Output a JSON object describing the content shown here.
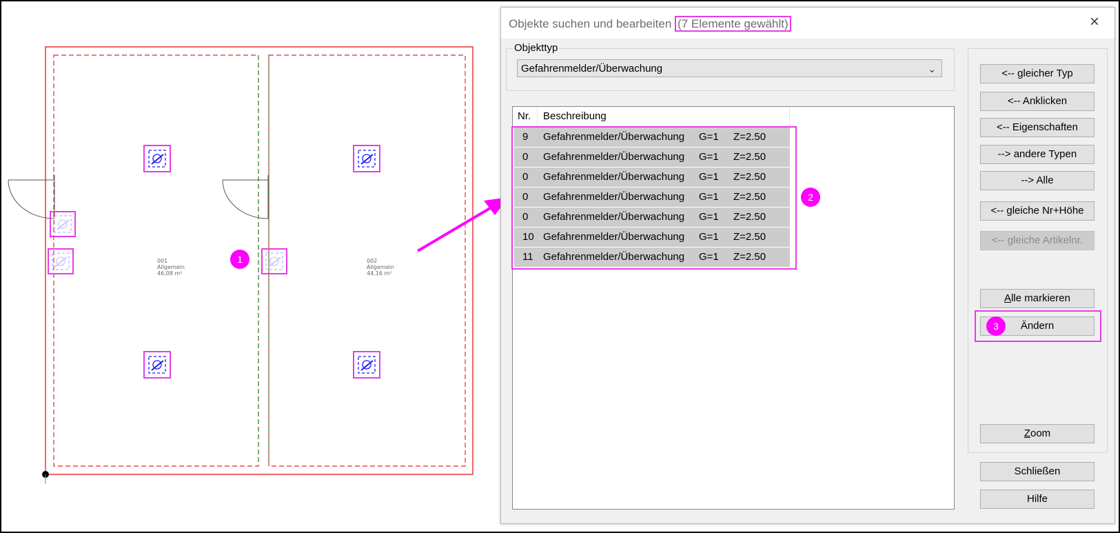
{
  "dialog": {
    "title": "Objekte suchen und bearbeiten",
    "title_count": "(7 Elemente gewählt)",
    "close_icon": "×"
  },
  "object_type": {
    "label": "Objekttyp",
    "selected": "Gefahrenmelder/Überwachung"
  },
  "list": {
    "headers": [
      "Nr.",
      "Beschreibung"
    ],
    "rows": [
      {
        "nr": "9",
        "desc": "Gefahrenmelder/Überwachung",
        "g": "G=1",
        "z": "Z=2.50"
      },
      {
        "nr": "0",
        "desc": "Gefahrenmelder/Überwachung",
        "g": "G=1",
        "z": "Z=2.50"
      },
      {
        "nr": "0",
        "desc": "Gefahrenmelder/Überwachung",
        "g": "G=1",
        "z": "Z=2.50"
      },
      {
        "nr": "0",
        "desc": "Gefahrenmelder/Überwachung",
        "g": "G=1",
        "z": "Z=2.50"
      },
      {
        "nr": "0",
        "desc": "Gefahrenmelder/Überwachung",
        "g": "G=1",
        "z": "Z=2.50"
      },
      {
        "nr": "10",
        "desc": "Gefahrenmelder/Überwachung",
        "g": "G=1",
        "z": "Z=2.50"
      },
      {
        "nr": "11",
        "desc": "Gefahrenmelder/Überwachung",
        "g": "G=1",
        "z": "Z=2.50"
      }
    ]
  },
  "buttons": {
    "same_type": "<-- gleicher Typ",
    "click": "<-- Anklicken",
    "properties": "<-- Eigenschaften",
    "other_types": "--> andere Typen",
    "all": "--> Alle",
    "same_nr_height": "<-- gleiche Nr+Höhe",
    "same_article": "<-- gleiche Artikelnr.",
    "mark_all_first": "A",
    "mark_all_rest": "lle markieren",
    "change": "Ändern",
    "zoom_first": "Z",
    "zoom_rest": "oom",
    "close": "Schließen",
    "help": "Hilfe"
  },
  "rooms": [
    {
      "number": "001",
      "name": "Allgemein",
      "area": "46,08 m²"
    },
    {
      "number": "002",
      "name": "Allgemein",
      "area": "44,16 m²"
    }
  ],
  "badges": [
    "1",
    "2",
    "3"
  ],
  "colors": {
    "highlight": "#e63ce6",
    "badge": "#ff00ff",
    "wall": "#e8262b",
    "symbol": "#1a1aff",
    "row_selected": "#cccccc"
  }
}
